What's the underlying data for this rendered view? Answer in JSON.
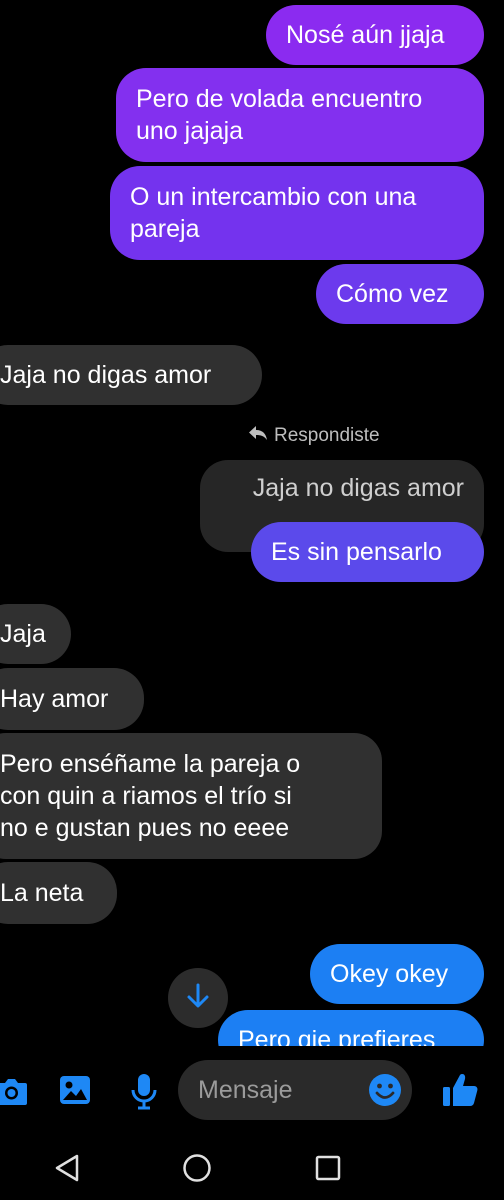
{
  "messages": [
    {
      "dir": "sent",
      "text": "Nosé aún jjaja"
    },
    {
      "dir": "sent",
      "text": [
        "Pero de volada encuentro",
        "uno jajaja"
      ]
    },
    {
      "dir": "sent",
      "text": [
        "O un intercambio con una",
        "pareja"
      ]
    },
    {
      "dir": "sent",
      "text": "Cómo vez"
    },
    {
      "dir": "recv",
      "text": "Jaja no digas amor"
    },
    {
      "dir": "sent",
      "text": "Es sin pensarlo",
      "reply_label": "Respondiste",
      "reply_quote": "Jaja no digas amor"
    },
    {
      "dir": "recv",
      "text": "Jaja"
    },
    {
      "dir": "recv",
      "text": "Hay amor"
    },
    {
      "dir": "recv",
      "text": [
        "Pero enséñame la pareja o",
        "con quin a riamos el trío si",
        "no e gustan pues no eeee"
      ]
    },
    {
      "dir": "recv",
      "text": "La neta"
    },
    {
      "dir": "sent",
      "text": "Okey okey"
    },
    {
      "dir": "sent",
      "text": "Pero qie prefieres"
    }
  ],
  "composer": {
    "placeholder": "Mensaje"
  },
  "colors": {
    "sent_purple": "#8B2BF0",
    "sent_violet": "#7433EE",
    "sent_indigo": "#5B4AEB",
    "sent_blue": "#1C7FF3",
    "received": "#303030",
    "accent": "#1E88F5"
  },
  "icons": [
    "camera-icon",
    "image-icon",
    "microphone-icon",
    "emoji-icon",
    "thumbs-up-icon",
    "arrow-down-icon",
    "back-nav-icon",
    "home-nav-icon",
    "recents-nav-icon",
    "reply-arrow-icon"
  ]
}
